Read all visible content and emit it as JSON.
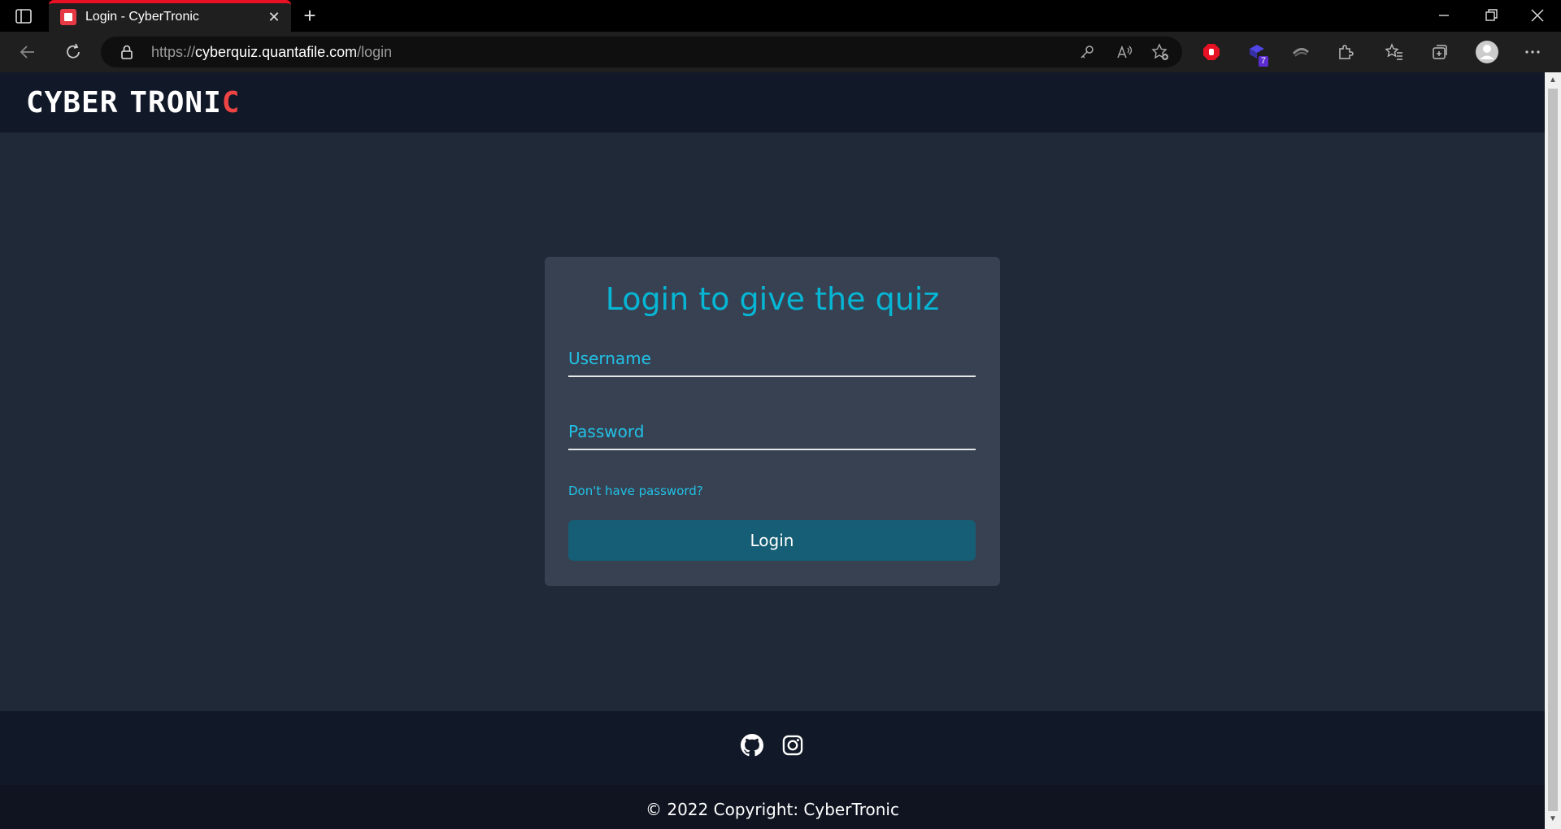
{
  "browser": {
    "tab_title": "Login - CyberTronic",
    "url_scheme": "https://",
    "url_host": "cyberquiz.quantafile.com",
    "url_path": "/login",
    "extension_badge": "7"
  },
  "header": {
    "logo_part1": "CYBER",
    "logo_part2": "TRONI",
    "logo_part3": "C"
  },
  "login": {
    "title": "Login to give the quiz",
    "username_placeholder": "Username",
    "password_placeholder": "Password",
    "forgot_link": "Don't have password?",
    "login_button": "Login"
  },
  "footer": {
    "copyright": "© 2022 Copyright:  CyberTronic"
  },
  "colors": {
    "accent": "#06b6d4",
    "button": "#155e75",
    "card": "#374151",
    "page_bg": "#1f2937",
    "nav_bg": "#111827"
  }
}
